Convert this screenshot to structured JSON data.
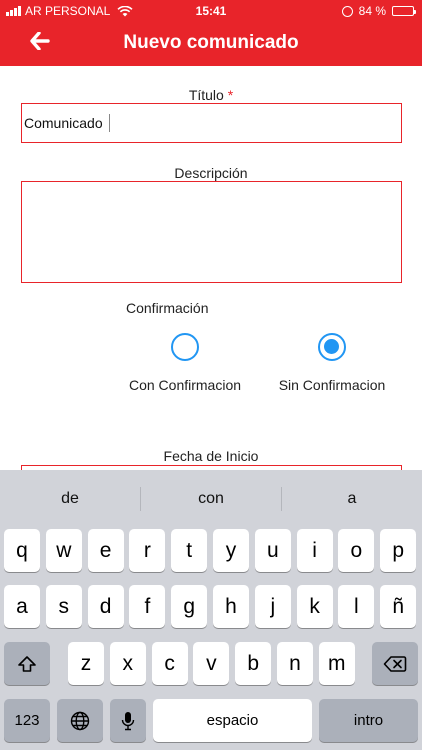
{
  "theme": {
    "accent": "#e8242a",
    "radio": "#2196f3",
    "keyboard_bg": "#d1d3d9"
  },
  "status_bar": {
    "carrier": "AR PERSONAL",
    "time": "15:41",
    "battery": "84 %",
    "battery_level": 0.84,
    "icons": [
      "signal-icon",
      "wifi-icon",
      "orientation-lock-icon",
      "battery-icon"
    ]
  },
  "header": {
    "back_icon": "arrow-left-icon",
    "title": "Nuevo comunicado"
  },
  "form": {
    "title_label": "Título",
    "required_mark": "*",
    "title_value": "Comunicado",
    "description_label": "Descripción",
    "description_value": "",
    "confirmation_label": "Confirmación",
    "options": [
      {
        "label": "Con Confirmacion",
        "selected": false
      },
      {
        "label": "Sin Confirmacion",
        "selected": true
      }
    ],
    "start_date_label": "Fecha de Inicio"
  },
  "keyboard": {
    "suggestions": [
      "de",
      "con",
      "a"
    ],
    "row1": [
      "q",
      "w",
      "e",
      "r",
      "t",
      "y",
      "u",
      "i",
      "o",
      "p"
    ],
    "row2": [
      "a",
      "s",
      "d",
      "f",
      "g",
      "h",
      "j",
      "k",
      "l",
      "ñ"
    ],
    "row3": [
      "z",
      "x",
      "c",
      "v",
      "b",
      "n",
      "m"
    ],
    "numbers_key": "123",
    "space_key": "espacio",
    "return_key": "intro",
    "icons": [
      "shift-icon",
      "backspace-icon",
      "globe-icon",
      "microphone-icon"
    ]
  }
}
